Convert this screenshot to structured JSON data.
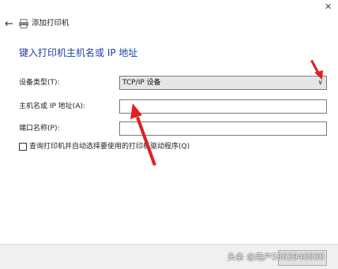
{
  "window": {
    "title": "添加打印机",
    "back_icon": "←",
    "close_icon": "✕"
  },
  "heading": "键入打印机主机名或 IP 地址",
  "form": {
    "device_type_label": "设备类型(T):",
    "device_type_value": "TCP/IP 设备",
    "hostname_label": "主机名或 IP 地址(A):",
    "hostname_value": "",
    "port_label": "端口名称(P):",
    "port_value": "",
    "query_checkbox_label": "查询打印机并自动选择要使用的打印机驱动程序(Q)",
    "query_checkbox_checked": false
  },
  "watermark": "头条 @用户5863940000",
  "annotation_color": "#e02020"
}
